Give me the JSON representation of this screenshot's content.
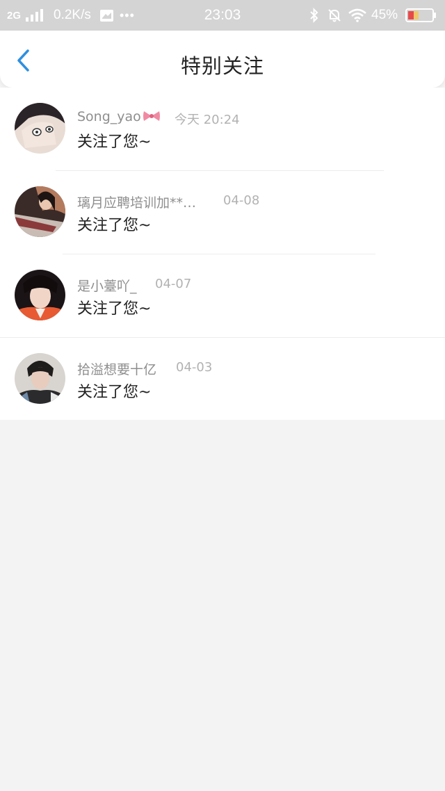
{
  "status_bar": {
    "network": "2G",
    "speed": "0.2K/s",
    "more": "•••",
    "time": "23:03",
    "battery": "45%"
  },
  "header": {
    "title": "特别关注"
  },
  "follows": [
    {
      "name": "Song_yao",
      "time": "今天 20:24",
      "message": "关注了您~"
    },
    {
      "name": "璃月应聘培训加**…",
      "time": "04-08",
      "message": "关注了您~"
    },
    {
      "name": "是小薹吖_",
      "time": "04-07",
      "message": "关注了您~"
    },
    {
      "name": "拾溢想要十亿",
      "time": "04-03",
      "message": "关注了您~"
    }
  ],
  "colors": {
    "accent": "#2f8fe0",
    "background": "#f4f3f4",
    "status_bar": "#d4d4d4",
    "battery_level": "#e64a4a"
  },
  "icons": [
    "back-arrow-icon",
    "signal-icon",
    "message-icon",
    "bluetooth-icon",
    "bell-off-icon",
    "wifi-icon",
    "battery-icon",
    "bow-icon"
  ]
}
